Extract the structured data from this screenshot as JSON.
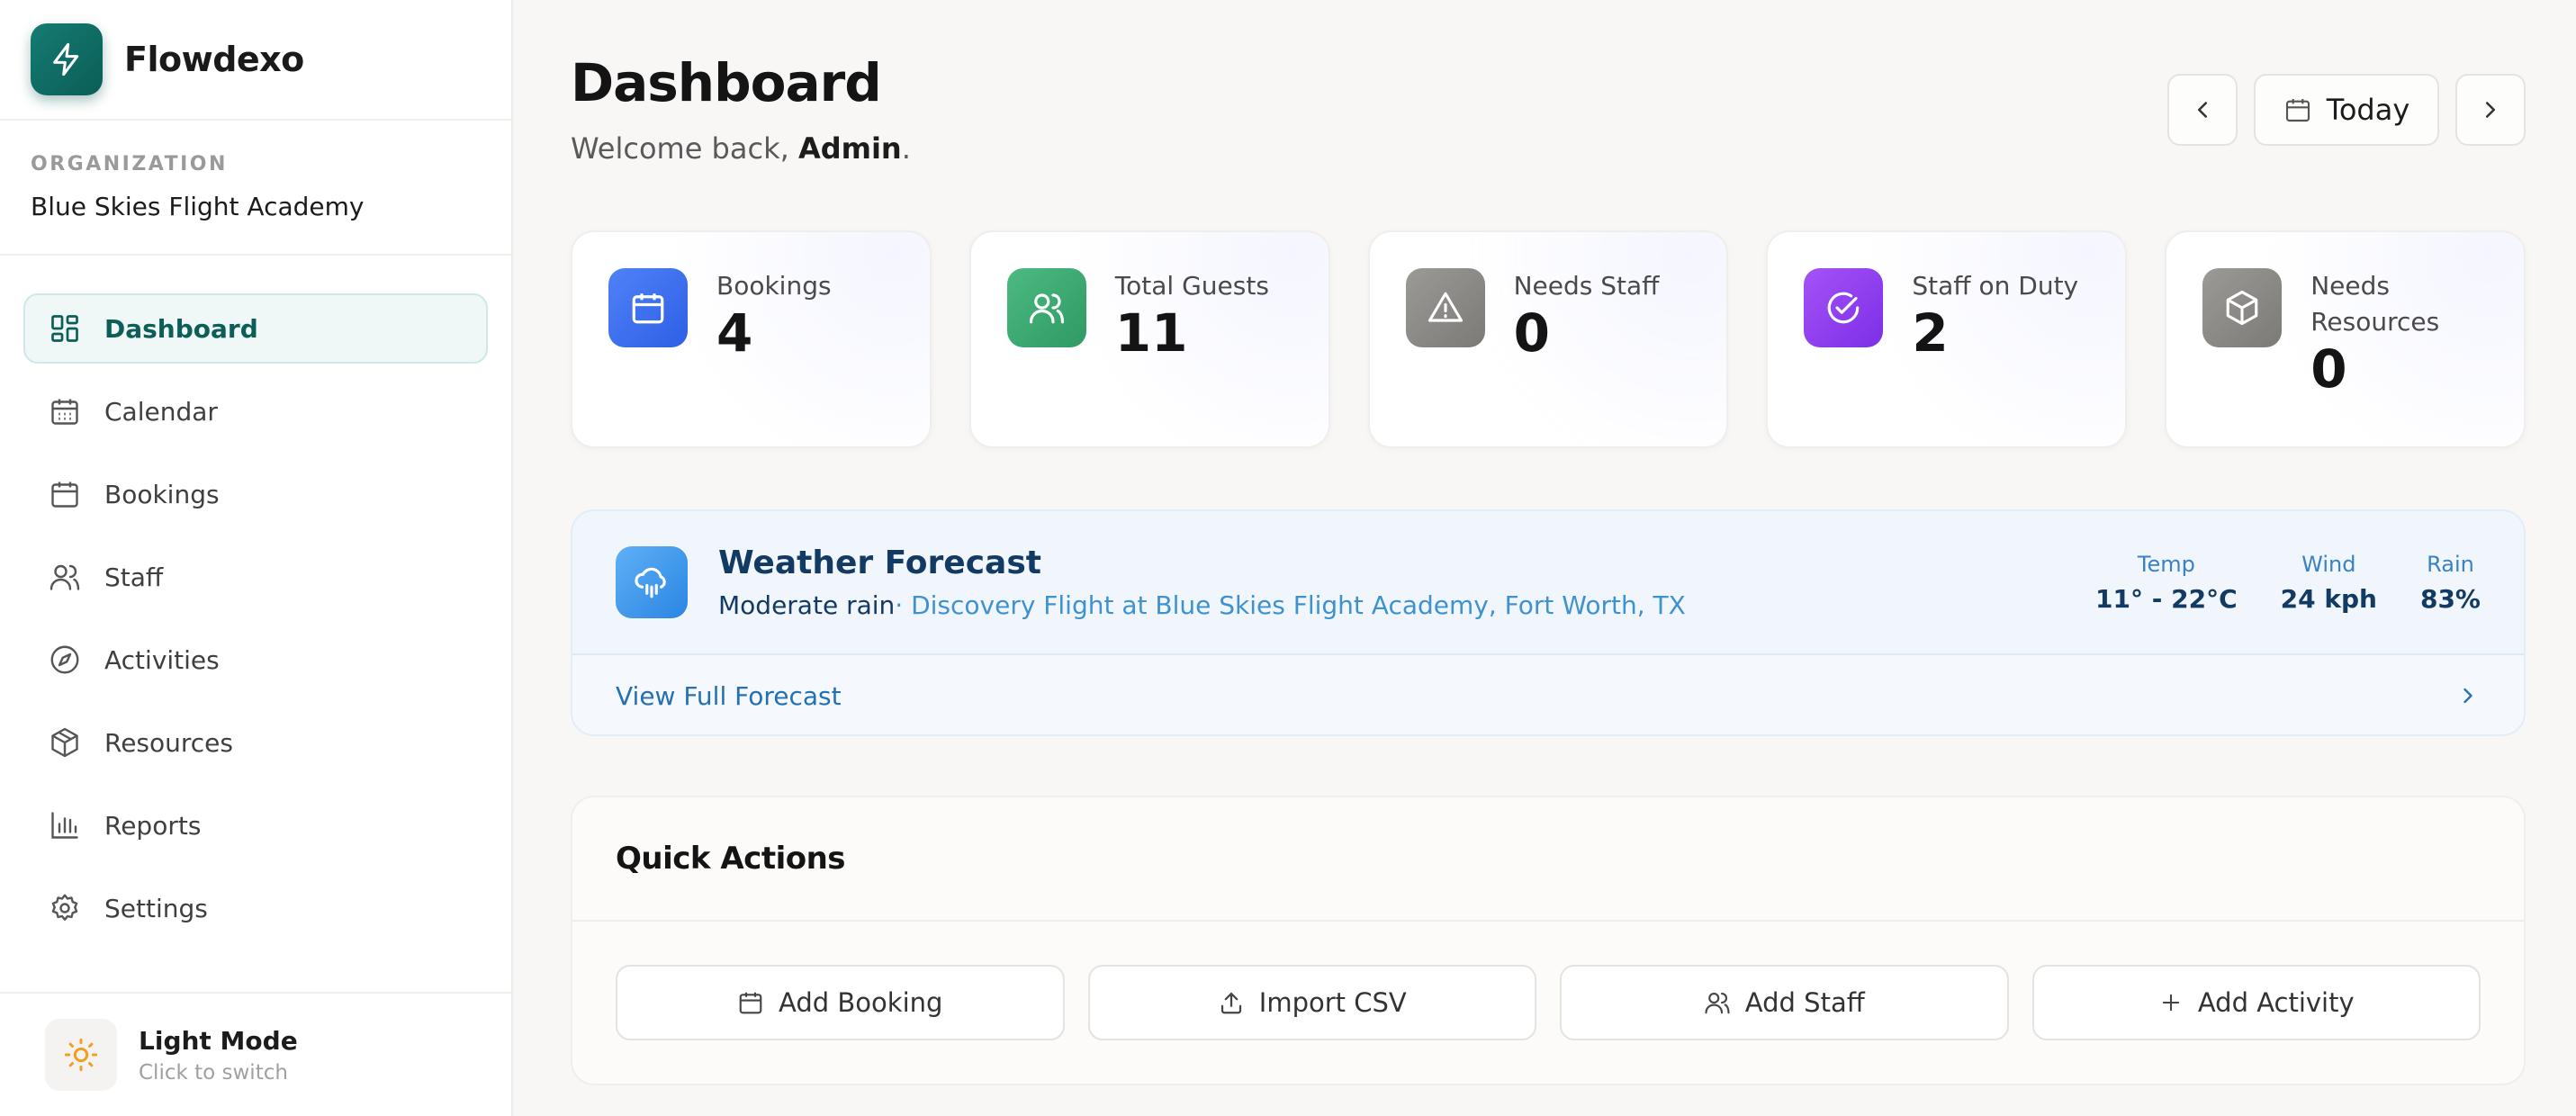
{
  "brand": {
    "name": "Flowdexo",
    "logo_icon": "bolt-icon"
  },
  "organization": {
    "label": "ORGANIZATION",
    "name": "Blue Skies Flight Academy"
  },
  "nav": {
    "items": [
      {
        "label": "Dashboard",
        "icon": "dashboard-icon",
        "active": true
      },
      {
        "label": "Calendar",
        "icon": "calendar-icon"
      },
      {
        "label": "Bookings",
        "icon": "bookings-icon"
      },
      {
        "label": "Staff",
        "icon": "staff-icon"
      },
      {
        "label": "Activities",
        "icon": "compass-icon"
      },
      {
        "label": "Resources",
        "icon": "package-icon"
      },
      {
        "label": "Reports",
        "icon": "bar-chart-icon"
      },
      {
        "label": "Settings",
        "icon": "gear-icon"
      }
    ]
  },
  "theme_toggle": {
    "title": "Light Mode",
    "subtitle": "Click to switch",
    "icon": "sun-icon"
  },
  "header": {
    "title": "Dashboard",
    "welcome_prefix": "Welcome back, ",
    "welcome_user": "Admin",
    "welcome_suffix": ".",
    "today_label": "Today"
  },
  "stats": [
    {
      "label": "Bookings",
      "value": "4",
      "color": "#3b6ff0"
    },
    {
      "label": "Total Guests",
      "value": "11",
      "color": "#3aa570"
    },
    {
      "label": "Needs Staff",
      "value": "0",
      "color": "#8c8a86"
    },
    {
      "label": "Staff on Duty",
      "value": "2",
      "color": "#8a3cf0"
    },
    {
      "label": "Needs Resources",
      "value": "0",
      "color": "#8c8a86"
    }
  ],
  "weather": {
    "title": "Weather Forecast",
    "condition": "Moderate rain",
    "location": "· Discovery Flight at Blue Skies Flight Academy, Fort Worth, TX",
    "metrics": [
      {
        "label": "Temp",
        "value": "11° - 22°C"
      },
      {
        "label": "Wind",
        "value": "24 kph"
      },
      {
        "label": "Rain",
        "value": "83%"
      }
    ],
    "link": "View Full Forecast"
  },
  "quick_actions": {
    "title": "Quick Actions",
    "buttons": [
      {
        "label": "Add Booking",
        "icon": "calendar-icon"
      },
      {
        "label": "Import CSV",
        "icon": "upload-icon"
      },
      {
        "label": "Add Staff",
        "icon": "users-icon"
      },
      {
        "label": "Add Activity",
        "icon": "plus-icon"
      }
    ]
  }
}
